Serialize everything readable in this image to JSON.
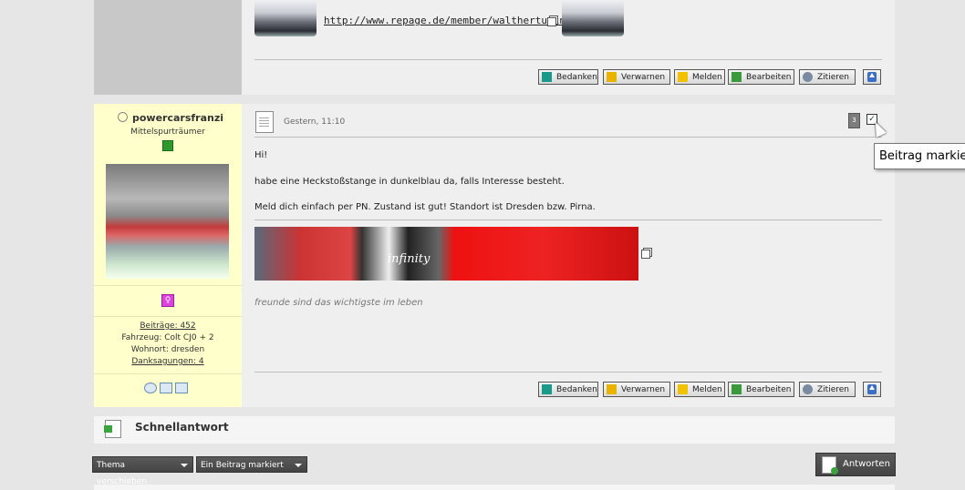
{
  "prev_post": {
    "link_text": "http://www.repage.de/member/walthertuning",
    "buttons": [
      "Bedanken",
      "Verwarnen",
      "Melden",
      "Bearbeiten",
      "Zitieren"
    ]
  },
  "post": {
    "author": {
      "name": "powercarsfranzi",
      "rank": "Mittelspurträumer",
      "stats": {
        "beitraege": "Beiträge: 452",
        "fahrzeug": "Fahrzeug: Colt CJ0 + 2",
        "wohnort": "Wohnort: dresden",
        "danksagungen": "Danksagungen: 4"
      }
    },
    "date": "Gestern, 11:10",
    "post_number": "3",
    "tooltip": "Beitrag markie",
    "lines": [
      "Hi!",
      "habe eine Heckstoßstange in dunkelblau da, falls Interesse besteht.",
      "Meld dich einfach per PN. Zustand ist gut! Standort ist Dresden bzw. Pirna."
    ],
    "signature_logo": "infinity",
    "signature_text": "freunde sind das wichtigste im leben",
    "buttons": [
      "Bedanken",
      "Verwarnen",
      "Melden",
      "Bearbeiten",
      "Zitieren"
    ]
  },
  "quick_reply": {
    "label": "Schnellantwort"
  },
  "footer": {
    "move_thread": "Thema verschieben",
    "marked": "Ein Beitrag markiert",
    "reply": "Antworten"
  },
  "colors": {
    "sidebar": "#ffffcc",
    "panel": "#efefef",
    "background": "#e6e6e6"
  }
}
